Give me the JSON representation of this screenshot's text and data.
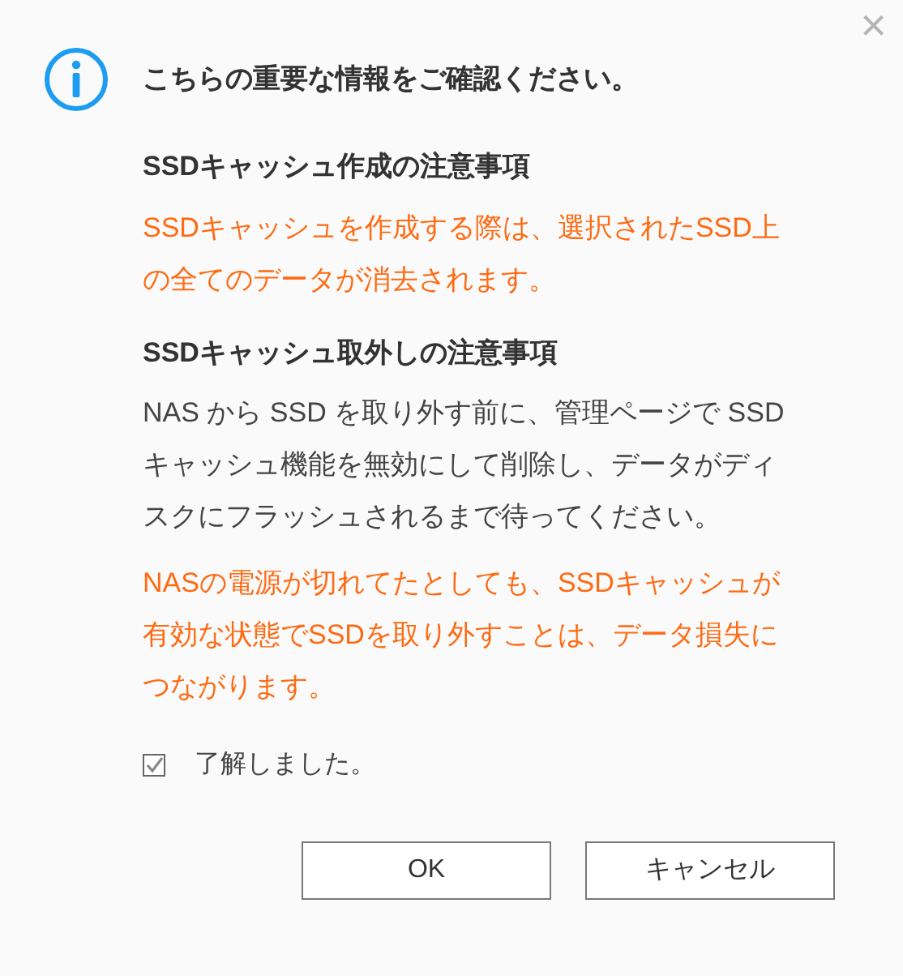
{
  "dialog": {
    "close": "×",
    "heading": "こちらの重要な情報をご確認ください。",
    "sections": [
      {
        "title": "SSDキャッシュ作成の注意事項",
        "paragraphs": [
          {
            "kind": "warning",
            "text": "SSDキャッシュを作成する際は、選択されたSSD上の全てのデータが消去されます。"
          }
        ]
      },
      {
        "title": "SSDキャッシュ取外しの注意事項",
        "paragraphs": [
          {
            "kind": "normal",
            "text": "NAS から SSD を取り外す前に、管理ページで SSD キャッシュ機能を無効にして削除し、データがディスクにフラッシュされるまで待ってください。"
          },
          {
            "kind": "warning",
            "text": "NASの電源が切れてたとしても、SSDキャッシュが有効な状態でSSDを取り外すことは、データ損失につながります。"
          }
        ]
      }
    ],
    "confirm": {
      "label": "了解しました。",
      "checked": true
    },
    "buttons": [
      "OK",
      "キャンセル"
    ]
  }
}
